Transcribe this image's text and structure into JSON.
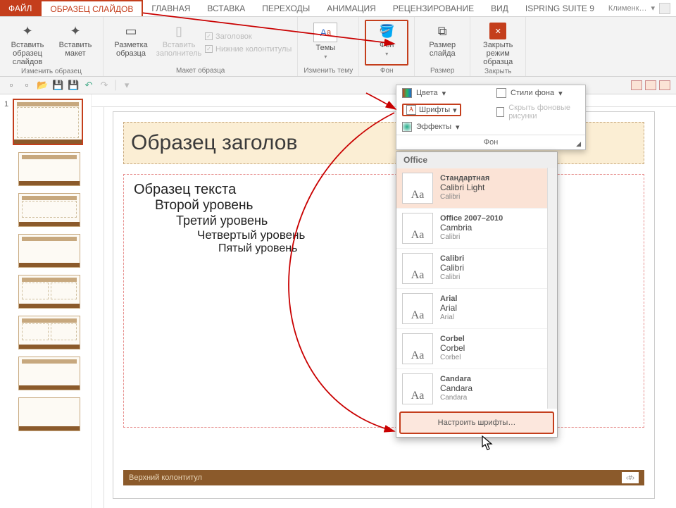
{
  "tabs": {
    "file": "ФАЙЛ",
    "master": "ОБРАЗЕЦ СЛАЙДОВ",
    "home": "ГЛАВНАЯ",
    "insert": "ВСТАВКА",
    "transitions": "ПЕРЕХОДЫ",
    "animation": "АНИМАЦИЯ",
    "review": "РЕЦЕНЗИРОВАНИЕ",
    "view": "ВИД",
    "ispring": "ISPRING SUITE 9",
    "user": "Клименк…"
  },
  "ribbon": {
    "insert_master": "Вставить\nобразец слайдов",
    "insert_layout": "Вставить\nмакет",
    "edit_master_group": "Изменить образец",
    "master_layout": "Разметка\nобразца",
    "insert_placeholder": "Вставить\nзаполнитель",
    "cb_title": "Заголовок",
    "cb_footers": "Нижние колонтитулы",
    "master_layout_group": "Макет образца",
    "themes": "Темы",
    "edit_theme_group": "Изменить тему",
    "background": "Фон",
    "background_group": "Фон",
    "slide_size": "Размер\nслайда",
    "size_group": "Размер",
    "close": "Закрыть\nрежим образца",
    "close_group": "Закрыть"
  },
  "bgpanel": {
    "colors": "Цвета",
    "styles": "Стили фона",
    "fonts": "Шрифты",
    "hide": "Скрыть фоновые рисунки",
    "effects": "Эффекты",
    "title": "Фон"
  },
  "slide": {
    "title": "Образец заголов",
    "l1": "Образец текста",
    "l2": "Второй уровень",
    "l3": "Третий уровень",
    "l4": "Четвертый уровень",
    "l5": "Пятый уровень",
    "footer": "Верхний колонтитул",
    "pagenum": "‹#›"
  },
  "fontdd": {
    "office": "Office",
    "items": [
      {
        "name": "Стандартная",
        "h": "Calibri Light",
        "b": "Calibri"
      },
      {
        "name": "Office 2007–2010",
        "h": "Cambria",
        "b": "Calibri"
      },
      {
        "name": "Calibri",
        "h": "Calibri",
        "b": "Calibri"
      },
      {
        "name": "Arial",
        "h": "Arial",
        "b": "Arial"
      },
      {
        "name": "Corbel",
        "h": "Corbel",
        "b": "Corbel"
      },
      {
        "name": "Candara",
        "h": "Candara",
        "b": "Candara"
      }
    ],
    "customize": "Настроить шрифты…"
  },
  "thumbnum": "1"
}
